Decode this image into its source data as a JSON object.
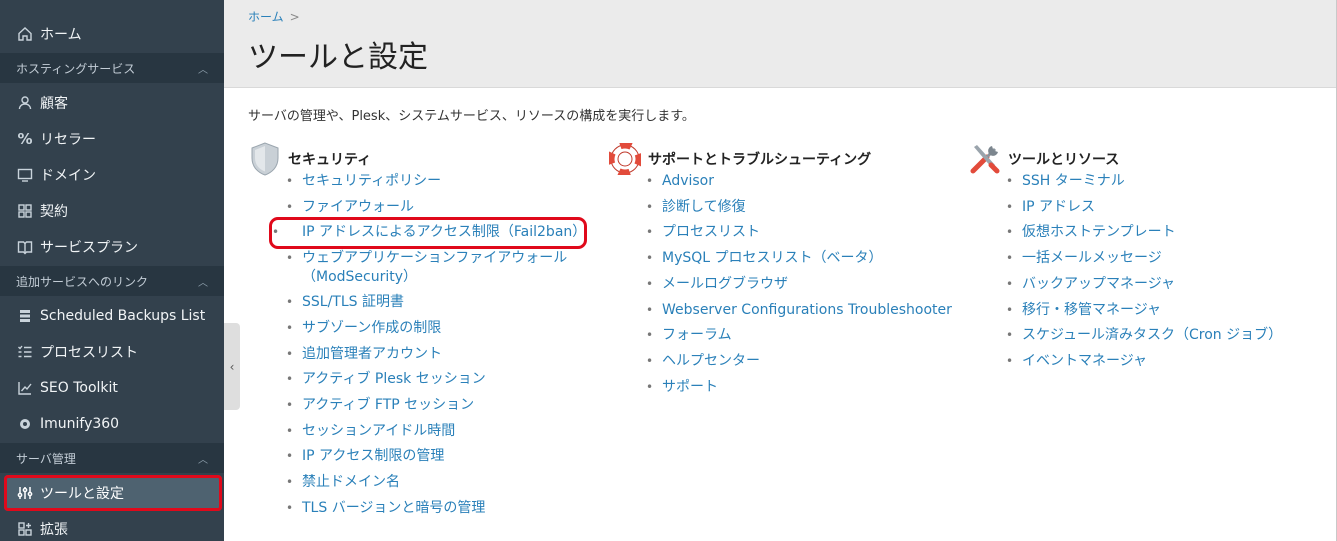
{
  "sidebar": {
    "home": "ホーム",
    "section_hosting": "ホスティングサービス",
    "customers": "顧客",
    "resellers": "リセラー",
    "domains": "ドメイン",
    "subscriptions": "契約",
    "service_plans": "サービスプラン",
    "section_links": "追加サービスへのリンク",
    "scheduled_backups": "Scheduled Backups List",
    "process_list": "プロセスリスト",
    "seo_toolkit": "SEO Toolkit",
    "imunify": "Imunify360",
    "section_server": "サーバ管理",
    "tools_settings": "ツールと設定",
    "extensions": "拡張"
  },
  "header": {
    "breadcrumb_home": "ホーム",
    "breadcrumb_sep": ">",
    "title": "ツールと設定"
  },
  "description": "サーバの管理や、Plesk、システムサービス、リソースの構成を実行します。",
  "security": {
    "title": "セキュリティ",
    "items": [
      "セキュリティポリシー",
      "ファイアウォール",
      "IP アドレスによるアクセス制限（Fail2ban）",
      "ウェブアプリケーションファイアウォール（ModSecurity）",
      "SSL/TLS 証明書",
      "サブゾーン作成の制限",
      "追加管理者アカウント",
      "アクティブ Plesk セッション",
      "アクティブ FTP セッション",
      "セッションアイドル時間",
      "IP アクセス制限の管理",
      "禁止ドメイン名",
      "TLS バージョンと暗号の管理"
    ]
  },
  "support": {
    "title": "サポートとトラブルシューティング",
    "items": [
      "Advisor",
      "診断して修復",
      "プロセスリスト",
      "MySQL プロセスリスト（ベータ）",
      "メールログブラウザ",
      "Webserver Configurations Troubleshooter",
      "フォーラム",
      "ヘルプセンター",
      "サポート"
    ]
  },
  "tools": {
    "title": "ツールとリソース",
    "items": [
      "SSH ターミナル",
      "IP アドレス",
      "仮想ホストテンプレート",
      "一括メールメッセージ",
      "バックアップマネージャ",
      "移行・移管マネージャ",
      "スケジュール済みタスク（Cron ジョブ）",
      "イベントマネージャ"
    ]
  },
  "colors": {
    "sidebar_bg": "#33414d",
    "section_bg": "#283641",
    "active_bg": "#4e6270",
    "highlight": "#e0091b",
    "link": "#2a80b9"
  }
}
